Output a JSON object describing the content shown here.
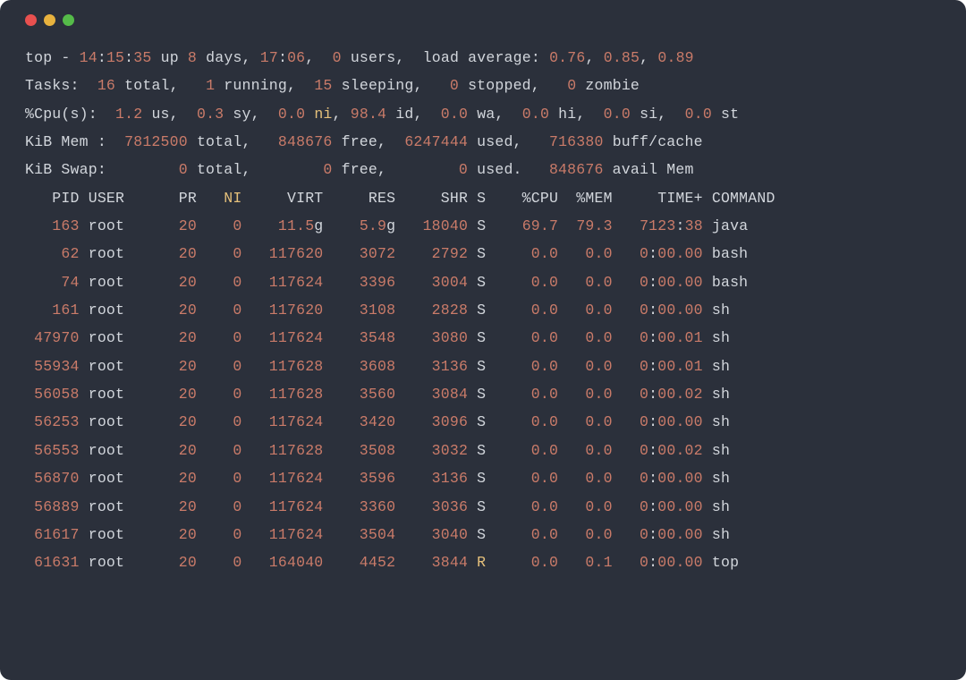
{
  "summary": {
    "line1": {
      "prefix": "top -",
      "time": "14:15:35",
      "up_word": "up",
      "up_value": "8",
      "days_word": "days,",
      "uptime_hm": "17:06",
      "users_count": "0",
      "users_word": "users,",
      "load_label": "load average:",
      "loads": [
        "0.76",
        "0.85",
        "0.89"
      ]
    },
    "tasks": {
      "label": "Tasks:",
      "total": "16",
      "total_w": "total,",
      "running": "1",
      "running_w": "running,",
      "sleeping": "15",
      "sleeping_w": "sleeping,",
      "stopped": "0",
      "stopped_w": "stopped,",
      "zombie": "0",
      "zombie_w": "zombie"
    },
    "cpu": {
      "label": "%Cpu(s):",
      "us": "1.2",
      "us_w": "us,",
      "sy": "0.3",
      "sy_w": "sy,",
      "ni": "0.0",
      "ni_w": "ni,",
      "id": "98.4",
      "id_w": "id,",
      "wa": "0.0",
      "wa_w": "wa,",
      "hi": "0.0",
      "hi_w": "hi,",
      "si": "0.0",
      "si_w": "si,",
      "st": "0.0",
      "st_w": "st"
    },
    "mem": {
      "label": "KiB Mem :",
      "total": "7812500",
      "total_w": "total,",
      "free": "848676",
      "free_w": "free,",
      "used": "6247444",
      "used_w": "used,",
      "buff": "716380",
      "buff_w": "buff/cache"
    },
    "swap": {
      "label": "KiB Swap:",
      "total": "0",
      "total_w": "total,",
      "free": "0",
      "free_w": "free,",
      "used": "0",
      "used_w": "used.",
      "avail": "848676",
      "avail_w": "avail Mem"
    }
  },
  "headers": [
    "PID",
    "USER",
    "PR",
    "NI",
    "VIRT",
    "RES",
    "SHR",
    "S",
    "%CPU",
    "%MEM",
    "TIME+",
    "COMMAND"
  ],
  "processes": [
    {
      "pid": "163",
      "user": "root",
      "pr": "20",
      "ni": "0",
      "virt": "11.5g",
      "res": "5.9g",
      "shr": "18040",
      "s": "S",
      "cpu": "69.7",
      "mem": "79.3",
      "time": "7123:38",
      "cmd": "java"
    },
    {
      "pid": "62",
      "user": "root",
      "pr": "20",
      "ni": "0",
      "virt": "117620",
      "res": "3072",
      "shr": "2792",
      "s": "S",
      "cpu": "0.0",
      "mem": "0.0",
      "time": "0:00.00",
      "cmd": "bash"
    },
    {
      "pid": "74",
      "user": "root",
      "pr": "20",
      "ni": "0",
      "virt": "117624",
      "res": "3396",
      "shr": "3004",
      "s": "S",
      "cpu": "0.0",
      "mem": "0.0",
      "time": "0:00.00",
      "cmd": "bash"
    },
    {
      "pid": "161",
      "user": "root",
      "pr": "20",
      "ni": "0",
      "virt": "117620",
      "res": "3108",
      "shr": "2828",
      "s": "S",
      "cpu": "0.0",
      "mem": "0.0",
      "time": "0:00.00",
      "cmd": "sh"
    },
    {
      "pid": "47970",
      "user": "root",
      "pr": "20",
      "ni": "0",
      "virt": "117624",
      "res": "3548",
      "shr": "3080",
      "s": "S",
      "cpu": "0.0",
      "mem": "0.0",
      "time": "0:00.01",
      "cmd": "sh"
    },
    {
      "pid": "55934",
      "user": "root",
      "pr": "20",
      "ni": "0",
      "virt": "117628",
      "res": "3608",
      "shr": "3136",
      "s": "S",
      "cpu": "0.0",
      "mem": "0.0",
      "time": "0:00.01",
      "cmd": "sh"
    },
    {
      "pid": "56058",
      "user": "root",
      "pr": "20",
      "ni": "0",
      "virt": "117628",
      "res": "3560",
      "shr": "3084",
      "s": "S",
      "cpu": "0.0",
      "mem": "0.0",
      "time": "0:00.02",
      "cmd": "sh"
    },
    {
      "pid": "56253",
      "user": "root",
      "pr": "20",
      "ni": "0",
      "virt": "117624",
      "res": "3420",
      "shr": "3096",
      "s": "S",
      "cpu": "0.0",
      "mem": "0.0",
      "time": "0:00.00",
      "cmd": "sh"
    },
    {
      "pid": "56553",
      "user": "root",
      "pr": "20",
      "ni": "0",
      "virt": "117628",
      "res": "3508",
      "shr": "3032",
      "s": "S",
      "cpu": "0.0",
      "mem": "0.0",
      "time": "0:00.02",
      "cmd": "sh"
    },
    {
      "pid": "56870",
      "user": "root",
      "pr": "20",
      "ni": "0",
      "virt": "117624",
      "res": "3596",
      "shr": "3136",
      "s": "S",
      "cpu": "0.0",
      "mem": "0.0",
      "time": "0:00.00",
      "cmd": "sh"
    },
    {
      "pid": "56889",
      "user": "root",
      "pr": "20",
      "ni": "0",
      "virt": "117624",
      "res": "3360",
      "shr": "3036",
      "s": "S",
      "cpu": "0.0",
      "mem": "0.0",
      "time": "0:00.00",
      "cmd": "sh"
    },
    {
      "pid": "61617",
      "user": "root",
      "pr": "20",
      "ni": "0",
      "virt": "117624",
      "res": "3504",
      "shr": "3040",
      "s": "S",
      "cpu": "0.0",
      "mem": "0.0",
      "time": "0:00.00",
      "cmd": "sh"
    },
    {
      "pid": "61631",
      "user": "root",
      "pr": "20",
      "ni": "0",
      "virt": "164040",
      "res": "4452",
      "shr": "3844",
      "s": "R",
      "cpu": "0.0",
      "mem": "0.1",
      "time": "0:00.00",
      "cmd": "top"
    }
  ]
}
